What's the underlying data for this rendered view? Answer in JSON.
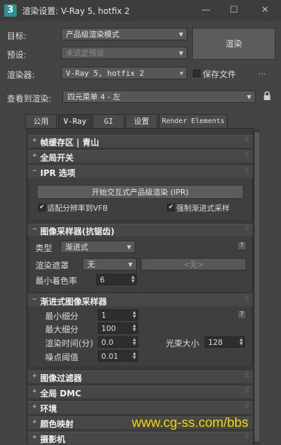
{
  "window": {
    "title": "渲染设置: V-Ray 5, hotfix 2",
    "icon_label": "3",
    "minimize_icon": "minimize-icon",
    "maximize_icon": "maximize-icon",
    "close_icon": "close-icon"
  },
  "top": {
    "target_label": "目标:",
    "target_value": "产品级渲染模式",
    "preset_label": "预设:",
    "preset_value": "未选定预设",
    "renderer_label": "渲染器:",
    "renderer_value": "V-Ray 5, hotfix 2",
    "save_file_label": "保存文件",
    "more_label": "...",
    "render_button": "渲染",
    "view_label": "查看到渲染:",
    "view_value": "四元菜单 4 - 左"
  },
  "tabs": [
    "公用",
    "V-Ray",
    "GI",
    "设置",
    "Render Elements"
  ],
  "active_tab": "V-Ray",
  "rollouts": {
    "frame_buffer": "帧缓存区 | 青山",
    "global_switches": "全局开关",
    "ipr": "IPR 选项",
    "image_sampler": "图像采样器(抗锯齿)",
    "progressive": "渐进式图像采样器",
    "image_filter": "图像过滤器",
    "global_dmc": "全局 DMC",
    "environment": "环境",
    "color_mapping": "颜色映射",
    "camera": "摄影机"
  },
  "ipr": {
    "start_button": "开始交互式产品级渲染 (IPR)",
    "fit_vfb_label": "适配分辨率到VFB",
    "fit_vfb_checked": true,
    "force_progressive_label": "强制渐进式采样",
    "force_progressive_checked": true
  },
  "image_sampler": {
    "type_label": "类型",
    "type_value": "渐进式",
    "mask_label": "渲染遮罩",
    "mask_value": "无",
    "mask_object": "<无>",
    "min_shading_label": "最小着色率",
    "min_shading_value": "6",
    "help": "?"
  },
  "progressive": {
    "min_subdivs_label": "最小细分",
    "min_subdivs_value": "1",
    "max_subdivs_label": "最大细分",
    "max_subdivs_value": "100",
    "render_time_label": "渲染时间(分)",
    "render_time_value": "0.0",
    "noise_label": "噪点阈值",
    "noise_value": "0.01",
    "bundle_label": "光束大小",
    "bundle_value": "128",
    "help": "?"
  },
  "watermark": "www.cg-ss.com/bbs"
}
